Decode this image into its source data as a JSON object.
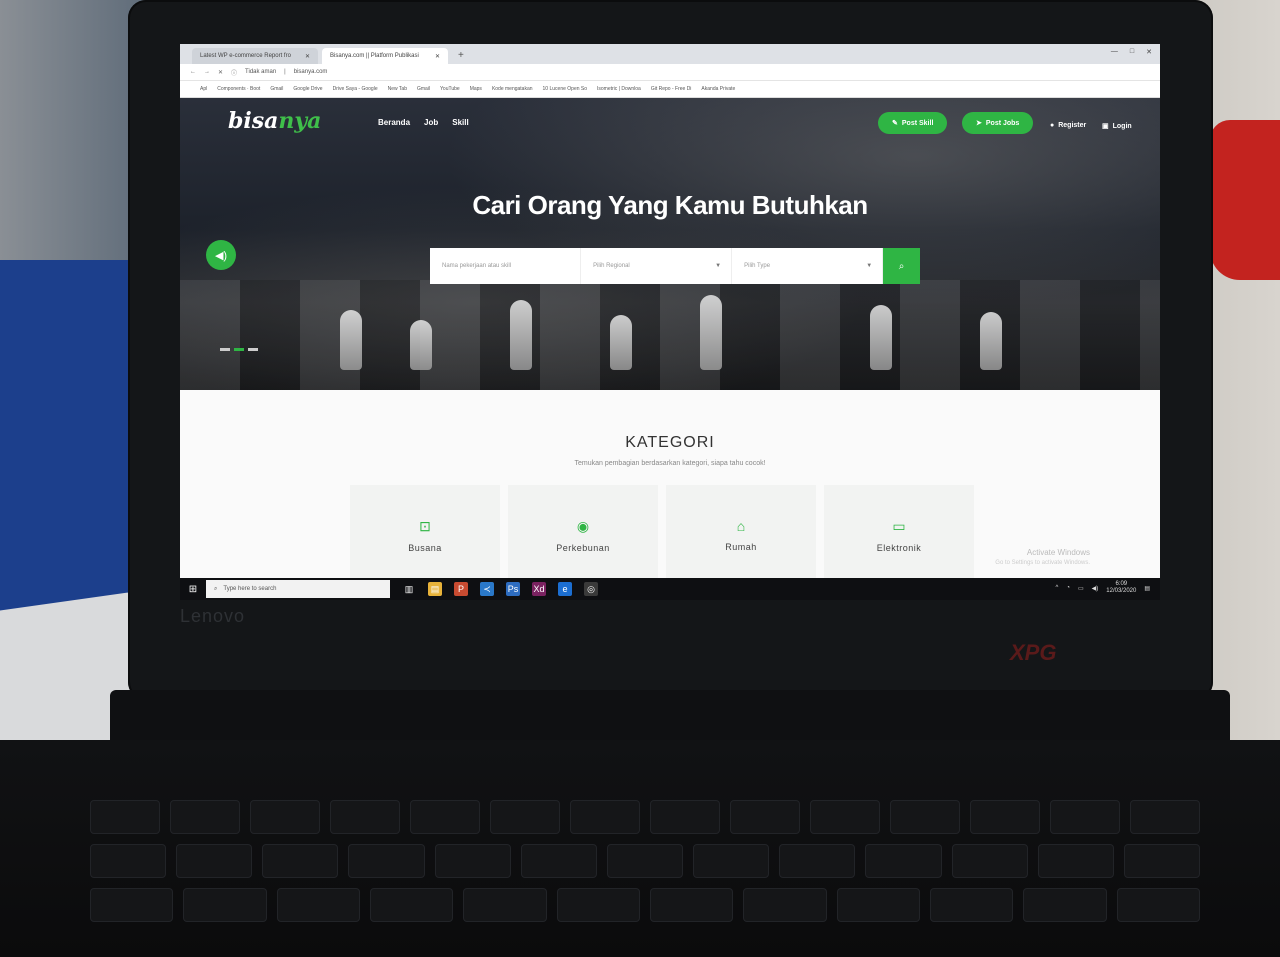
{
  "browser": {
    "tabs": [
      {
        "label": "Latest WP e-commerce Report fro"
      },
      {
        "label": "Bisanya.com || Platform Publikasi"
      }
    ],
    "address": {
      "security": "Tidak aman",
      "url": "bisanya.com"
    },
    "bookmarks": [
      "Apl",
      "Components · Boot",
      "Gmail",
      "Google Drive",
      "Drive Saya - Google",
      "New Tab",
      "Gmail",
      "YouTube",
      "Maps",
      "Kode mengatakan",
      "10 Lucene Open So",
      "Isometric | Downloa",
      "Git Repo - Free Di",
      "Akanda Private"
    ]
  },
  "site": {
    "logo_main": "bisa",
    "logo_accent": "nya",
    "nav": [
      "Beranda",
      "Job",
      "Skill"
    ],
    "post_skill": "Post Skill",
    "post_jobs": "Post Jobs",
    "register": "Register",
    "login": "Login",
    "hero_title": "Cari Orang Yang Kamu Butuhkan",
    "search": {
      "job_placeholder": "Nama pekerjaan atau skill",
      "region_placeholder": "Pilih Regional",
      "type_placeholder": "Pilih Type"
    },
    "kategori": {
      "title": "KATEGORI",
      "subtitle": "Temukan pembagian berdasarkan kategori, siapa tahu cocok!",
      "cards": [
        {
          "label": "Busana",
          "icon": "shirt-icon"
        },
        {
          "label": "Perkebunan",
          "icon": "dashboard-icon"
        },
        {
          "label": "Rumah",
          "icon": "home-icon"
        },
        {
          "label": "Elektronik",
          "icon": "monitor-icon"
        }
      ]
    },
    "activate_windows": "Activate Windows",
    "activate_sub": "Go to Settings to activate Windows."
  },
  "taskbar": {
    "search_placeholder": "Type here to search",
    "time": "6:09",
    "date": "12/03/2020"
  },
  "device": {
    "bezel_brand": "Lenovo",
    "badge": "XPG"
  },
  "colors": {
    "accent": "#2fb544",
    "taskbar": "#0e0f12"
  }
}
